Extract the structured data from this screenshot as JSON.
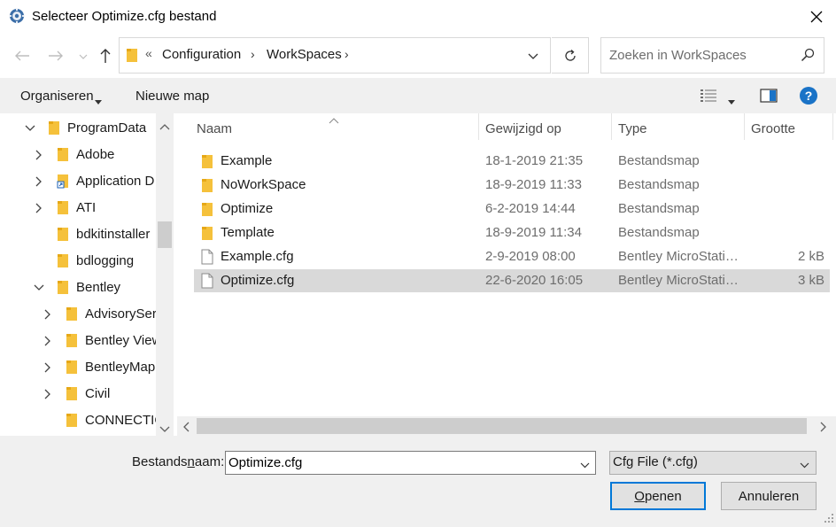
{
  "window": {
    "title": "Selecteer Optimize.cfg bestand",
    "close_glyph": "✕"
  },
  "address": {
    "overflow": "«",
    "crumbs": [
      "Configuration",
      "WorkSpaces"
    ],
    "separator": "›"
  },
  "search": {
    "placeholder": "Zoeken in WorkSpaces"
  },
  "toolbar": {
    "organize_label": "Organiseren",
    "new_folder_label": "Nieuwe map",
    "help_glyph": "?"
  },
  "tree": {
    "items": [
      {
        "label": "ProgramData",
        "expanded": true,
        "icon": "folder-icon"
      },
      {
        "label": "Adobe",
        "icon": "folder-icon"
      },
      {
        "label": "Application D",
        "icon": "shortcut-folder-icon"
      },
      {
        "label": "ATI",
        "icon": "folder-icon"
      },
      {
        "label": "bdkitinstaller",
        "icon": "folder-icon"
      },
      {
        "label": "bdlogging",
        "icon": "folder-icon"
      },
      {
        "label": "Bentley",
        "expanded": true,
        "icon": "folder-icon"
      },
      {
        "label": "AdvisorySer",
        "icon": "folder-icon"
      },
      {
        "label": "Bentley View",
        "icon": "folder-icon"
      },
      {
        "label": "BentleyMap",
        "icon": "folder-icon"
      },
      {
        "label": "Civil",
        "icon": "folder-icon"
      },
      {
        "label": "CONNECTIC",
        "icon": "folder-icon"
      }
    ]
  },
  "list": {
    "columns": [
      "Naam",
      "Gewijzigd op",
      "Type",
      "Grootte"
    ],
    "rows": [
      {
        "name": "Example",
        "modified": "18-1-2019 21:35",
        "type": "Bestandsmap",
        "size": "",
        "icon": "folder-icon"
      },
      {
        "name": "NoWorkSpace",
        "modified": "18-9-2019 11:33",
        "type": "Bestandsmap",
        "size": "",
        "icon": "folder-icon"
      },
      {
        "name": "Optimize",
        "modified": "6-2-2019 14:44",
        "type": "Bestandsmap",
        "size": "",
        "icon": "folder-icon"
      },
      {
        "name": "Template",
        "modified": "18-9-2019 11:34",
        "type": "Bestandsmap",
        "size": "",
        "icon": "folder-icon"
      },
      {
        "name": "Example.cfg",
        "modified": "2-9-2019 08:00",
        "type": "Bentley MicroStati…",
        "size": "2 kB",
        "icon": "file-icon"
      },
      {
        "name": "Optimize.cfg",
        "modified": "22-6-2020 16:05",
        "type": "Bentley MicroStati…",
        "size": "3 kB",
        "icon": "file-icon",
        "selected": true
      }
    ]
  },
  "bottom": {
    "filename_label_pre": "Bestands",
    "filename_label_u": "n",
    "filename_label_post": "aam:",
    "filename_value": "Optimize.cfg",
    "filter_value": "Cfg File (*.cfg)",
    "open_u": "O",
    "open_rest": "penen",
    "cancel_label": "Annuleren"
  },
  "colors": {
    "accent": "#0078d7",
    "folder": "#f5c13b",
    "help": "#1a73c7",
    "selected_row": "#d9d9d9"
  }
}
